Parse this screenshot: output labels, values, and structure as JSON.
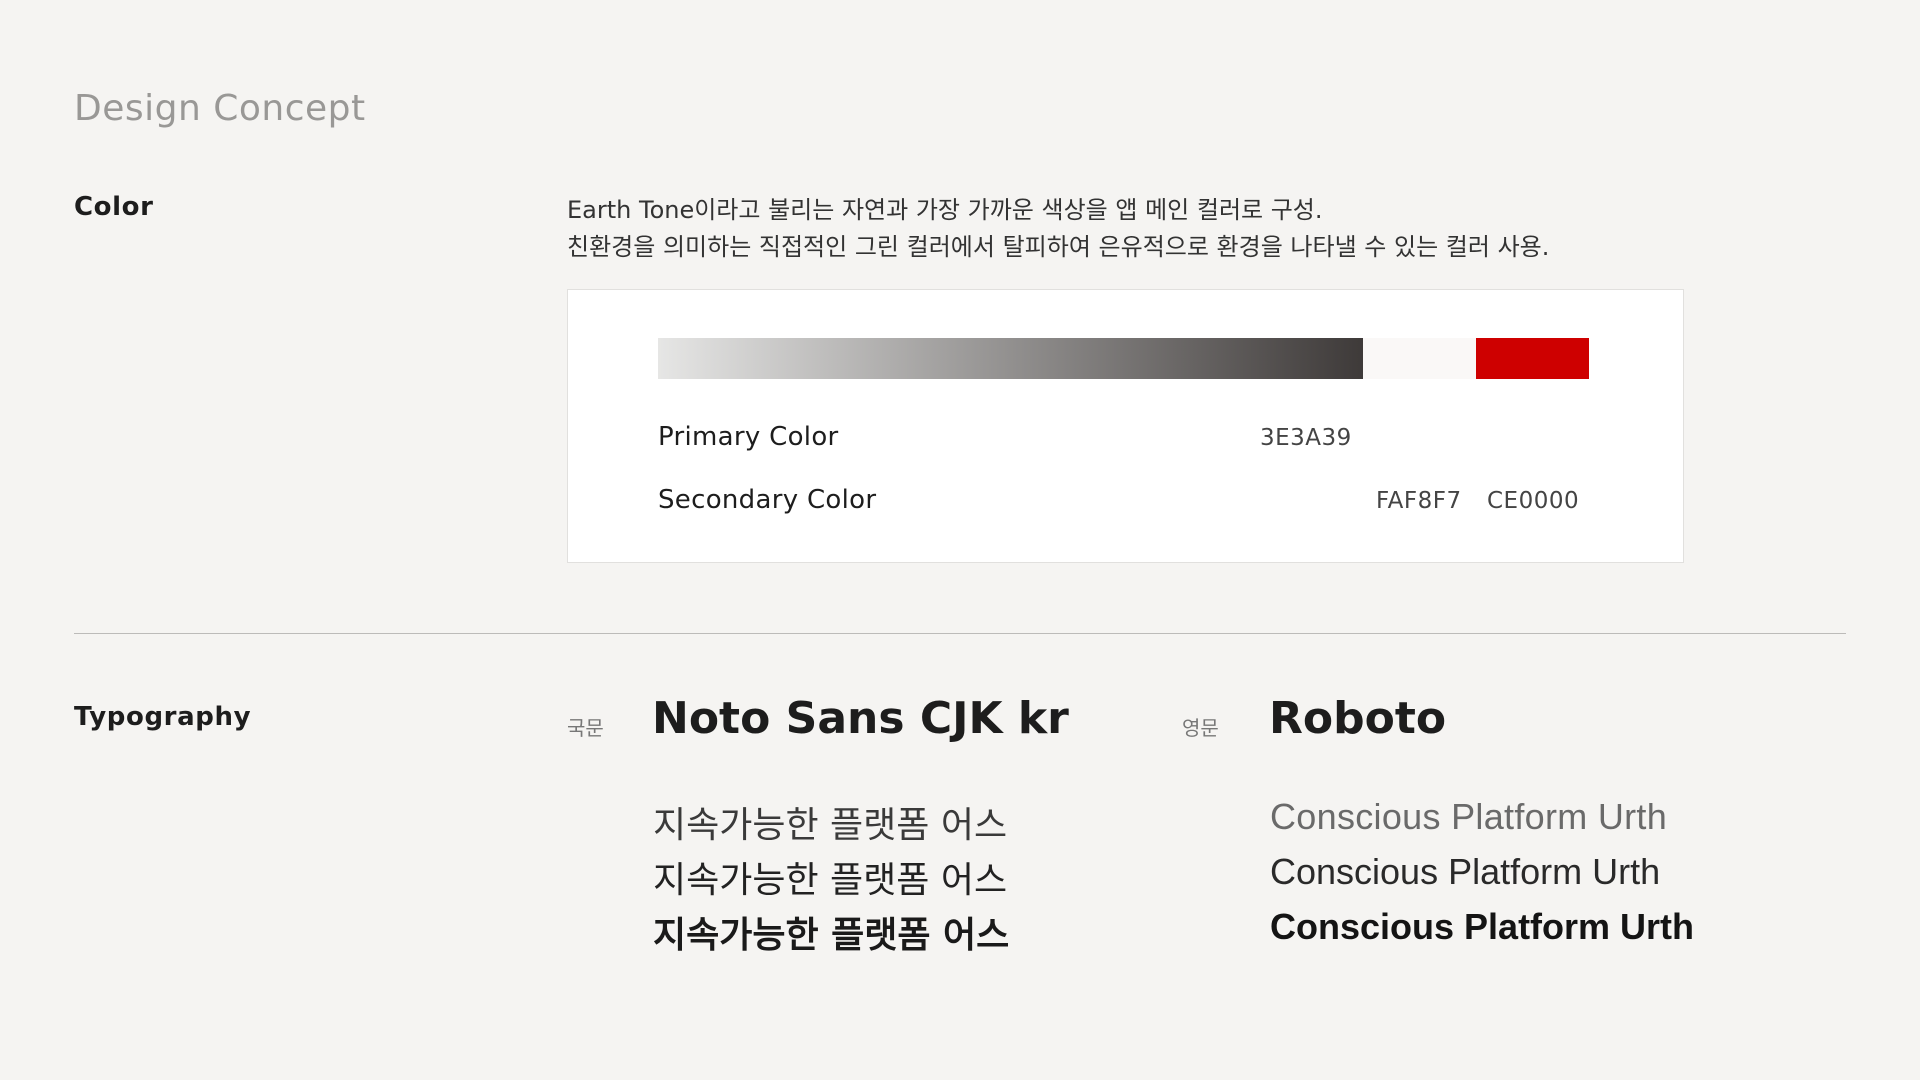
{
  "page_title": "Design Concept",
  "color": {
    "label": "Color",
    "description": [
      "Earth Tone이라고 불리는 자연과 가장 가까운 색상을 앱 메인 컬러로 구성.",
      "친환경을 의미하는 직접적인 그린 컬러에서 탈피하여 은유적으로 환경을 나타낼 수 있는 컬러 사용."
    ],
    "swatches": {
      "gradient_start": "#E6E6E5",
      "primary": "#3E3A39",
      "secondary_light": "#FAF8F7",
      "secondary_red": "#CE0000"
    },
    "primary_label": "Primary Color",
    "primary_hex": "3E3A39",
    "secondary_label": "Secondary Color",
    "secondary_hex": [
      "FAF8F7",
      "CE0000"
    ]
  },
  "typography": {
    "label": "Typography",
    "korean": {
      "tag": "국문",
      "font_name": "Noto Sans CJK kr",
      "samples": [
        "지속가능한 플랫폼 어스",
        "지속가능한 플랫폼 어스",
        "지속가능한 플랫폼 어스"
      ]
    },
    "english": {
      "tag": "영문",
      "font_name": "Roboto",
      "samples": [
        "Conscious Platform Urth",
        "Conscious Platform Urth",
        "Conscious Platform Urth"
      ]
    }
  }
}
